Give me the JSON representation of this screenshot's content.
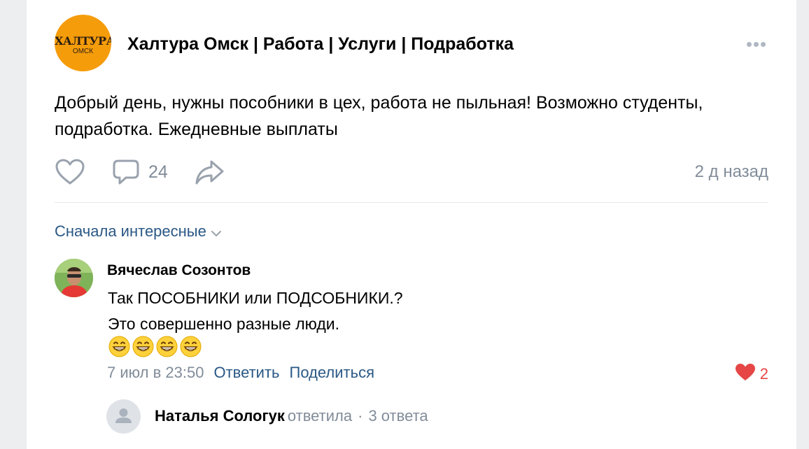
{
  "post": {
    "group_logo_main": "ХАЛТУРА",
    "group_logo_sub": "ОМСК",
    "group_name": "Халтура Омск | Работа | Услуги | Подработка",
    "more_icon": "more-horizontal-icon",
    "text": "Добрый день, нужны пособники в цех, работа не пыльная! Возможно студенты, подработка. Ежедневные выплаты",
    "comments_count": "24",
    "time": "2 д назад",
    "accent_color": "#f59c0b"
  },
  "comments": {
    "sort_label": "Сначала интересные",
    "items": [
      {
        "author": "Вячеслав Созонтов",
        "line1": "Так ПОСОБНИКИ или ПОДСОБНИКИ.?",
        "line2": "Это совершенно разные люди.",
        "emoji": "grinning-face-with-smiling-eyes",
        "emoji_count": 4,
        "date": "7 июл в 23:50",
        "reply_label": "Ответить",
        "share_label": "Поделиться",
        "likes": "2"
      }
    ],
    "reply_preview": {
      "author": "Наталья Сологук",
      "verb": "ответила",
      "separator": "·",
      "count": "3 ответа"
    }
  },
  "colors": {
    "link": "#2a5885",
    "secondary_text": "#818c99",
    "like_red": "#e64646",
    "icon_gray": "#99a2ad"
  }
}
